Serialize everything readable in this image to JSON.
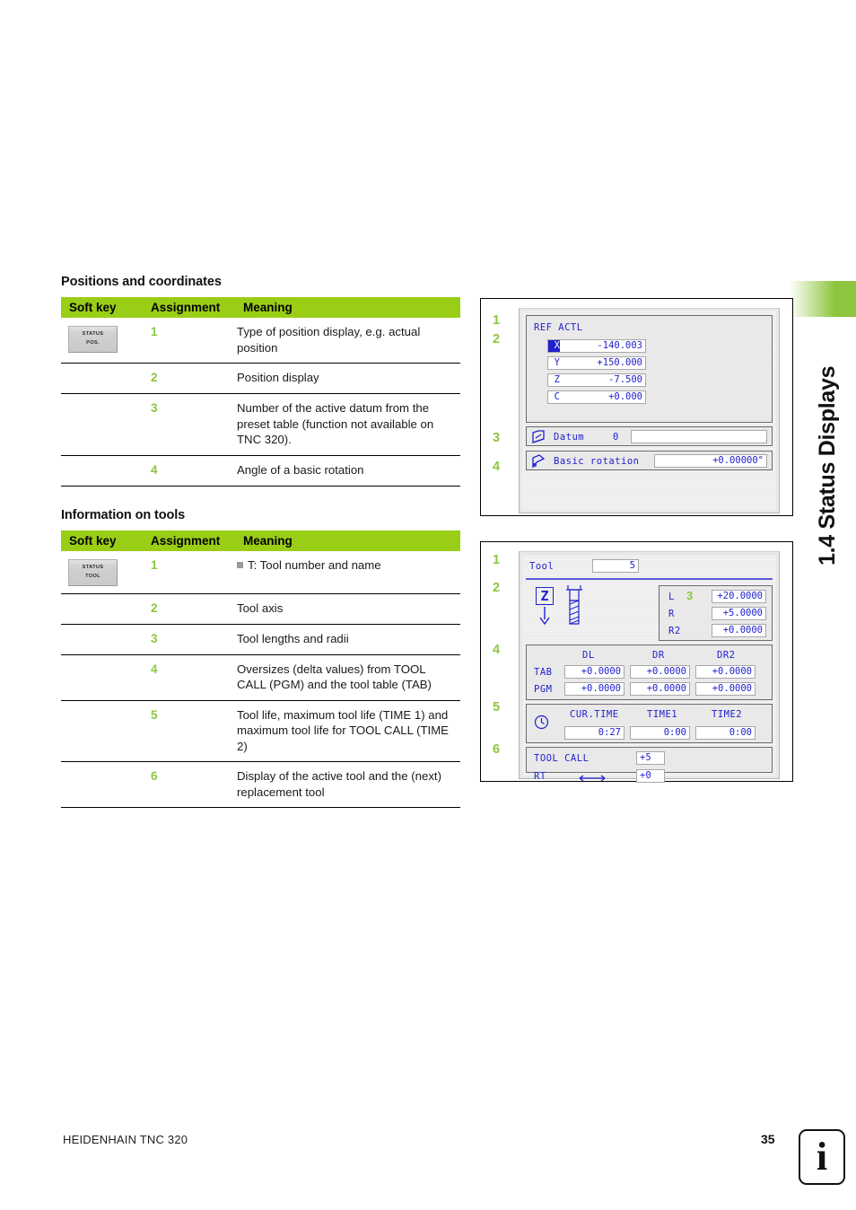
{
  "chapter": {
    "tab_title": "1.4 Status Displays"
  },
  "sections": [
    {
      "heading": "Positions and coordinates",
      "columns": [
        "Soft key",
        "Assignment",
        "Meaning"
      ],
      "softkey": {
        "line1": "STATUS",
        "line2": "POS."
      },
      "rows": [
        {
          "assignment": "1",
          "meaning": "Type of position display, e.g. actual position"
        },
        {
          "assignment": "2",
          "meaning": "Position display"
        },
        {
          "assignment": "3",
          "meaning": "Number of the active datum from the preset table (function not available on TNC 320)."
        },
        {
          "assignment": "4",
          "meaning": "Angle of a basic rotation"
        }
      ]
    },
    {
      "heading": "Information on tools",
      "columns": [
        "Soft key",
        "Assignment",
        "Meaning"
      ],
      "softkey": {
        "line1": "STATUS",
        "line2": "TOOL"
      },
      "rows": [
        {
          "assignment": "1",
          "meaning": "T: Tool number and name",
          "bullet": true
        },
        {
          "assignment": "2",
          "meaning": "Tool axis"
        },
        {
          "assignment": "3",
          "meaning": "Tool lengths and radii"
        },
        {
          "assignment": "4",
          "meaning": "Oversizes (delta values) from TOOL CALL (PGM) and the tool table (TAB)"
        },
        {
          "assignment": "5",
          "meaning": "Tool life, maximum tool life (TIME 1) and maximum tool life for TOOL CALL (TIME 2)"
        },
        {
          "assignment": "6",
          "meaning": "Display of the active tool and the (next) replacement tool"
        }
      ]
    }
  ],
  "screenshot_positions": {
    "callouts": [
      "1",
      "2",
      "3",
      "4"
    ],
    "mode_label": "REF ACTL",
    "axes": [
      {
        "name": "X",
        "value": "-140.003",
        "highlighted": true
      },
      {
        "name": "Y",
        "value": "+150.000",
        "highlighted": false
      },
      {
        "name": "Z",
        "value": "-7.500",
        "highlighted": false
      },
      {
        "name": "C",
        "value": "+0.000",
        "highlighted": false
      }
    ],
    "datum": {
      "label": "Datum",
      "number": "0",
      "value": ""
    },
    "basic_rotation": {
      "label": "Basic rotation",
      "value": "+0.00000°"
    }
  },
  "screenshot_tool": {
    "callouts": [
      "1",
      "2",
      "3",
      "4",
      "5",
      "6"
    ],
    "tool": {
      "label": "Tool",
      "number": "5"
    },
    "tool_axis": "Z",
    "geometry": [
      {
        "label": "L",
        "value": "+20.0000"
      },
      {
        "label": "R",
        "value": "+5.0000"
      },
      {
        "label": "R2",
        "value": "+0.0000"
      }
    ],
    "delta_table": {
      "columns": [
        "DL",
        "DR",
        "DR2"
      ],
      "rows": [
        {
          "label": "TAB",
          "values": [
            "+0.0000",
            "+0.0000",
            "+0.0000"
          ]
        },
        {
          "label": "PGM",
          "values": [
            "+0.0000",
            "+0.0000",
            "+0.0000"
          ]
        }
      ]
    },
    "times": {
      "columns": [
        "CUR.TIME",
        "TIME1",
        "TIME2"
      ],
      "values": [
        "0:27",
        "0:00",
        "0:00"
      ]
    },
    "calls": [
      {
        "label": "TOOL CALL",
        "value": "+5"
      },
      {
        "label": "RT",
        "value": "+0"
      }
    ]
  },
  "footer": {
    "product": "HEIDENHAIN TNC 320",
    "page": "35",
    "badge": "i"
  }
}
